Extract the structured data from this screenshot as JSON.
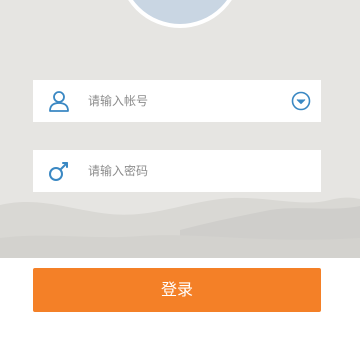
{
  "login": {
    "account_placeholder": "请输入帐号",
    "password_placeholder": "请输入密码",
    "submit_label": "登录"
  },
  "icons": {
    "account": "user-icon",
    "password": "key-icon",
    "dropdown": "chevron-down-circle-icon"
  },
  "colors": {
    "background": "#e6e5e2",
    "accent": "#f48027",
    "icon": "#3a88c3",
    "avatar": "#c9d6e3"
  }
}
